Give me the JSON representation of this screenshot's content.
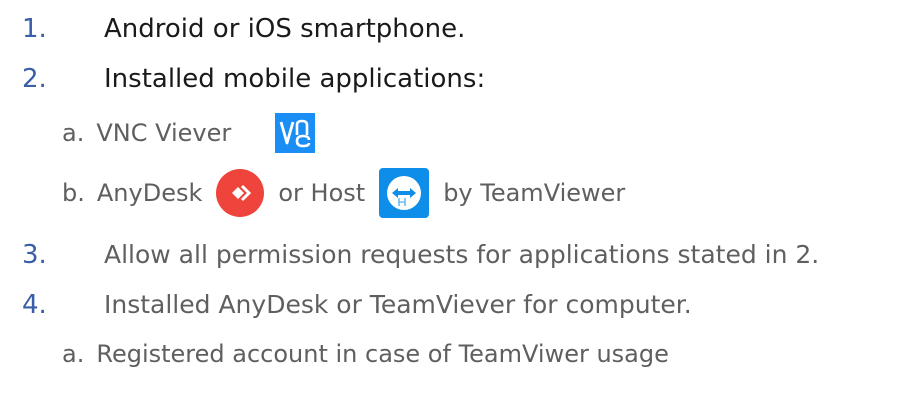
{
  "items": [
    {
      "number": "1.",
      "text": "Android or iOS smartphone."
    },
    {
      "number": "2.",
      "text": "Installed mobile applications:"
    },
    {
      "number": "3.",
      "text": "Allow all permission requests for applications stated in 2."
    },
    {
      "number": "4.",
      "text": "Installed AnyDesk or TeamViever for computer."
    }
  ],
  "sub_items": {
    "vnc": {
      "letter": "a.",
      "text": "VNC Viever"
    },
    "anydesk": {
      "letter": "b.",
      "text_1": "AnyDesk",
      "text_2": "or Host",
      "text_3": "by TeamViewer"
    },
    "registered": {
      "letter": "a.",
      "text": "Registered account in case of TeamViwer usage"
    }
  },
  "icons": {
    "vnc": "vnc-viewer-logo",
    "anydesk": "anydesk-logo",
    "teamviewer": "teamviewer-host-logo"
  },
  "colors": {
    "number": "#3a5ea8",
    "vnc_blue": "#1a8ef5",
    "anydesk_red": "#ef443b",
    "teamviewer_blue": "#0e8ee9"
  }
}
